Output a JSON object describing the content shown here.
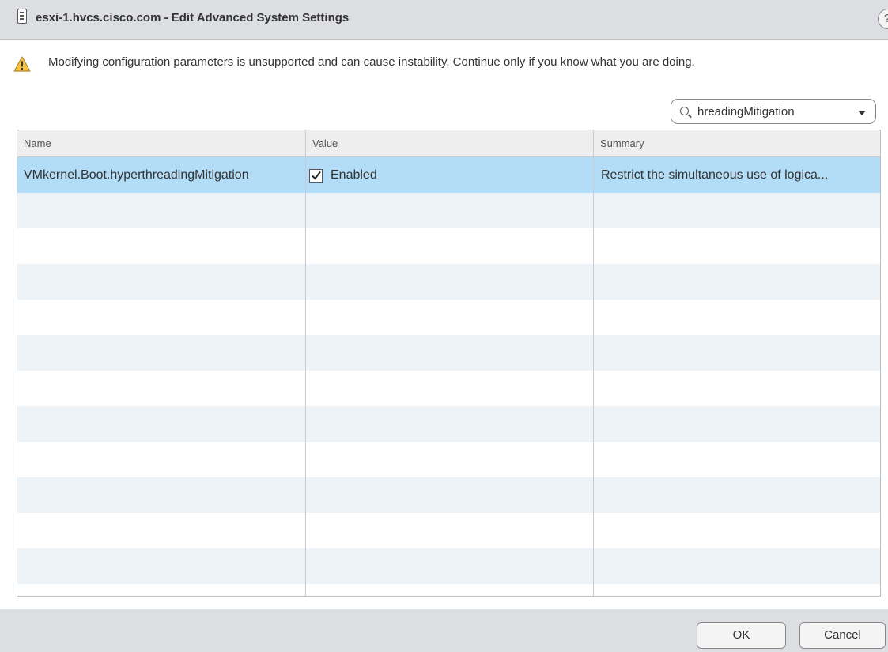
{
  "dialog": {
    "title": "esxi-1.hvcs.cisco.com - Edit Advanced System Settings",
    "help_label": "?"
  },
  "warning": {
    "icon": "warning-triangle-icon",
    "text": "Modifying configuration parameters is unsupported and can cause instability. Continue only if you know what you are doing."
  },
  "search": {
    "icon": "search-icon",
    "value": "hreadingMitigation"
  },
  "table": {
    "columns": [
      "Name",
      "Value",
      "Summary"
    ],
    "rows": [
      {
        "name": "VMkernel.Boot.hyperthreadingMitigation",
        "value": "Enabled",
        "checked": true,
        "summary": "Restrict the simultaneous use of logica..."
      }
    ]
  },
  "buttons": {
    "ok": "OK",
    "cancel": "Cancel"
  },
  "colors": {
    "selected_row": "#b3dcf6",
    "alt_row": "#eef3f8",
    "titlebar": "#dcdee2",
    "warning": "#f6c342"
  }
}
